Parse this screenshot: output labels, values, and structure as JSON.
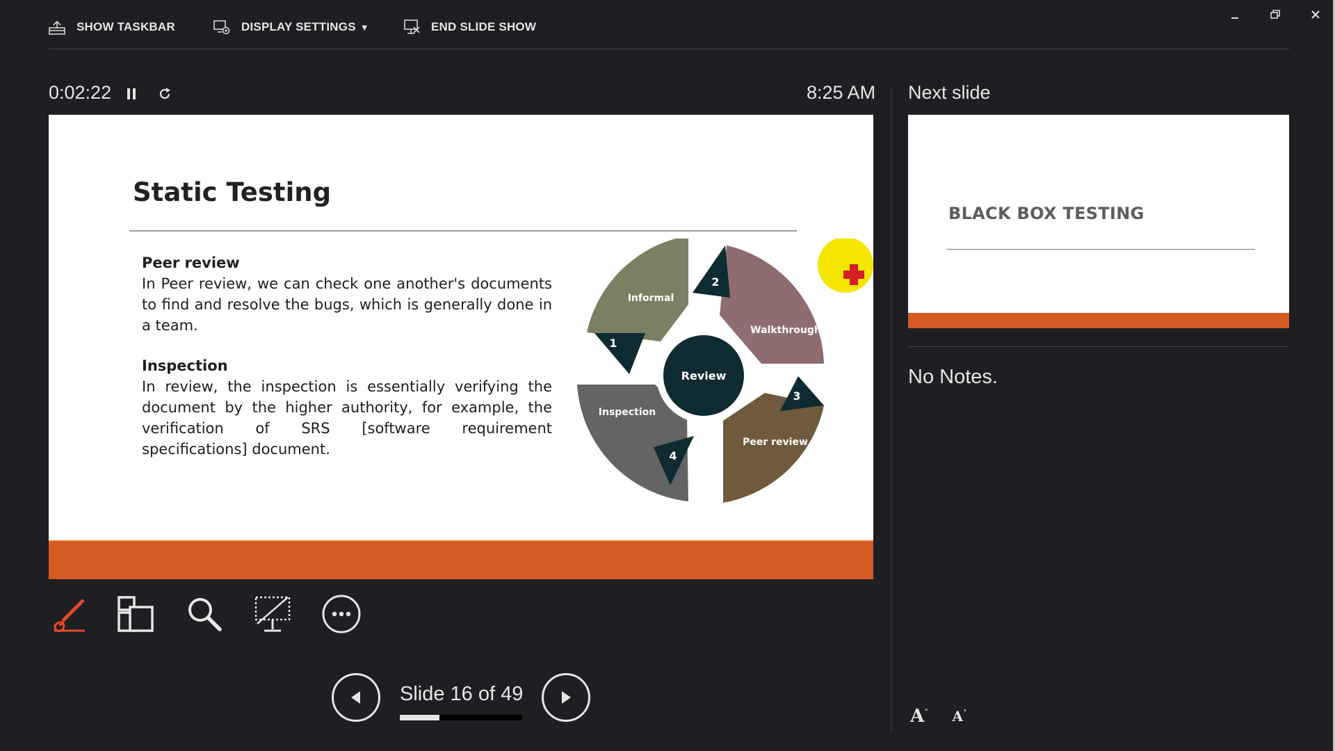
{
  "toolbar": {
    "show_taskbar": "SHOW TASKBAR",
    "display_settings": "DISPLAY SETTINGS",
    "end_slide_show": "END SLIDE SHOW"
  },
  "timer": {
    "elapsed": "0:02:22",
    "clock": "8:25 AM"
  },
  "slide": {
    "title": "Static Testing",
    "sections": [
      {
        "heading": "Peer review",
        "text": "In Peer review, we can check one another's documents to find and resolve the bugs, which is generally done in a team."
      },
      {
        "heading": "Inspection",
        "text": "In review, the inspection is essentially verifying the document by the higher authority, for example, the verification of SRS [software requirement specifications] document."
      }
    ],
    "diagram": {
      "center": "Review",
      "segments": [
        {
          "number": "1",
          "label": "Informal",
          "color": "#7b7f63"
        },
        {
          "number": "2",
          "label": "Walkthrough",
          "color": "#8e6c6f"
        },
        {
          "number": "3",
          "label": "Peer review",
          "color": "#6f5a3e"
        },
        {
          "number": "4",
          "label": "Inspection",
          "color": "#646464"
        }
      ],
      "marker_color": "#d41f26",
      "highlight_color": "#f5e600"
    },
    "band_color": "#d45a24"
  },
  "navigation": {
    "slide_label": "Slide 16 of 49",
    "current": 16,
    "total": 49,
    "progress_fraction": 0.3265
  },
  "next_slide": {
    "label": "Next slide",
    "title": "BLACK BOX TESTING"
  },
  "notes": {
    "text": "No Notes."
  },
  "icons": {
    "show_taskbar": "taskbar-icon",
    "display_settings": "display-settings-icon",
    "end_slide_show": "end-show-icon",
    "pause": "pause-icon",
    "reset": "reset-icon",
    "pen": "pen-icon",
    "see_all": "see-all-slides-icon",
    "zoom": "zoom-icon",
    "black_screen": "black-screen-icon",
    "more": "more-options-icon",
    "prev": "previous-slide-icon",
    "next": "next-slide-icon"
  },
  "colors": {
    "background": "#1f1e22",
    "accent_orange": "#d45a24",
    "pen_red": "#e04a2a"
  }
}
